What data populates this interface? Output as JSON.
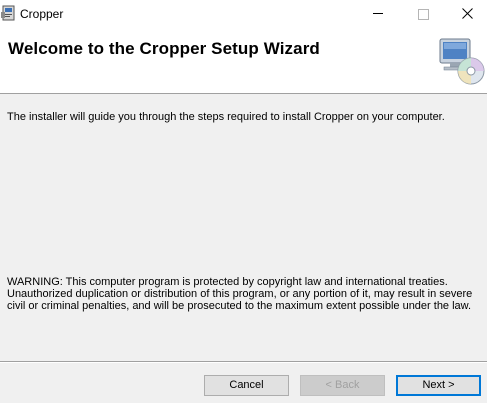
{
  "window": {
    "title": "Cropper",
    "minimize_icon": "minimize-icon",
    "maximize_icon": "maximize-icon",
    "close_icon": "close-icon"
  },
  "banner": {
    "title": "Welcome to the Cropper Setup Wizard",
    "icon": "computer-cd-icon"
  },
  "body": {
    "intro": "The installer will guide you through the steps required to install Cropper on your computer.",
    "warning": "WARNING: This computer program is protected by copyright law and international treaties. Unauthorized duplication or distribution of this program, or any portion of it, may result in severe civil or criminal penalties, and will be prosecuted to the maximum extent possible under the law."
  },
  "buttons": {
    "cancel": "Cancel",
    "back": "< Back",
    "next": "Next >"
  },
  "colors": {
    "accent": "#0078d7",
    "dialog_bg": "#f0f0f0",
    "disabled_text": "#a0a0a0"
  }
}
